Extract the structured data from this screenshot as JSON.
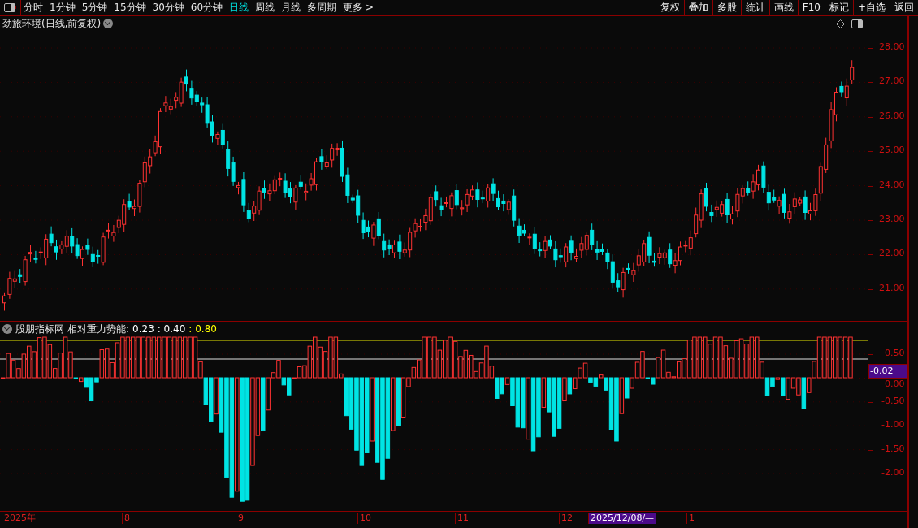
{
  "toolbar": {
    "periods": [
      {
        "label": "分时",
        "selected": false
      },
      {
        "label": "1分钟",
        "selected": false
      },
      {
        "label": "5分钟",
        "selected": false
      },
      {
        "label": "15分钟",
        "selected": false
      },
      {
        "label": "30分钟",
        "selected": false
      },
      {
        "label": "60分钟",
        "selected": false
      },
      {
        "label": "日线",
        "selected": true
      },
      {
        "label": "周线",
        "selected": false
      },
      {
        "label": "月线",
        "selected": false
      },
      {
        "label": "多周期",
        "selected": false
      },
      {
        "label": "更多 >",
        "selected": false
      }
    ],
    "actions": [
      "复权",
      "叠加",
      "多股",
      "统计",
      "画线",
      "F10",
      "标记",
      "+自选",
      "返回"
    ]
  },
  "main_chart": {
    "title": "劲旅环境(日线,前复权)",
    "price_axis": [
      "28.00",
      "27.00",
      "26.00",
      "25.00",
      "24.00",
      "23.00",
      "22.00",
      "21.00"
    ]
  },
  "indicator": {
    "source": "股朋指标网",
    "name": "相对重力势能:",
    "values": [
      {
        "text": "0.23",
        "color": "#ffffff"
      },
      {
        "text": ": 0.40",
        "color": "#ffffff"
      },
      {
        "text": ": 0.80",
        "color": "#ffff00"
      }
    ],
    "axis": [
      "0.50",
      "0.00",
      "-0.50",
      "-1.00",
      "-1.50",
      "-2.00"
    ],
    "current_value": "-0.02"
  },
  "time_axis": [
    {
      "text": "2025年",
      "kind": "month"
    },
    {
      "text": "8",
      "kind": "month"
    },
    {
      "text": "9",
      "kind": "month"
    },
    {
      "text": "10",
      "kind": "month"
    },
    {
      "text": "11",
      "kind": "month"
    },
    {
      "text": "12",
      "kind": "month"
    },
    {
      "text": "2025/12/08/—",
      "kind": "cursor"
    },
    {
      "text": "1",
      "kind": "month"
    }
  ]
}
